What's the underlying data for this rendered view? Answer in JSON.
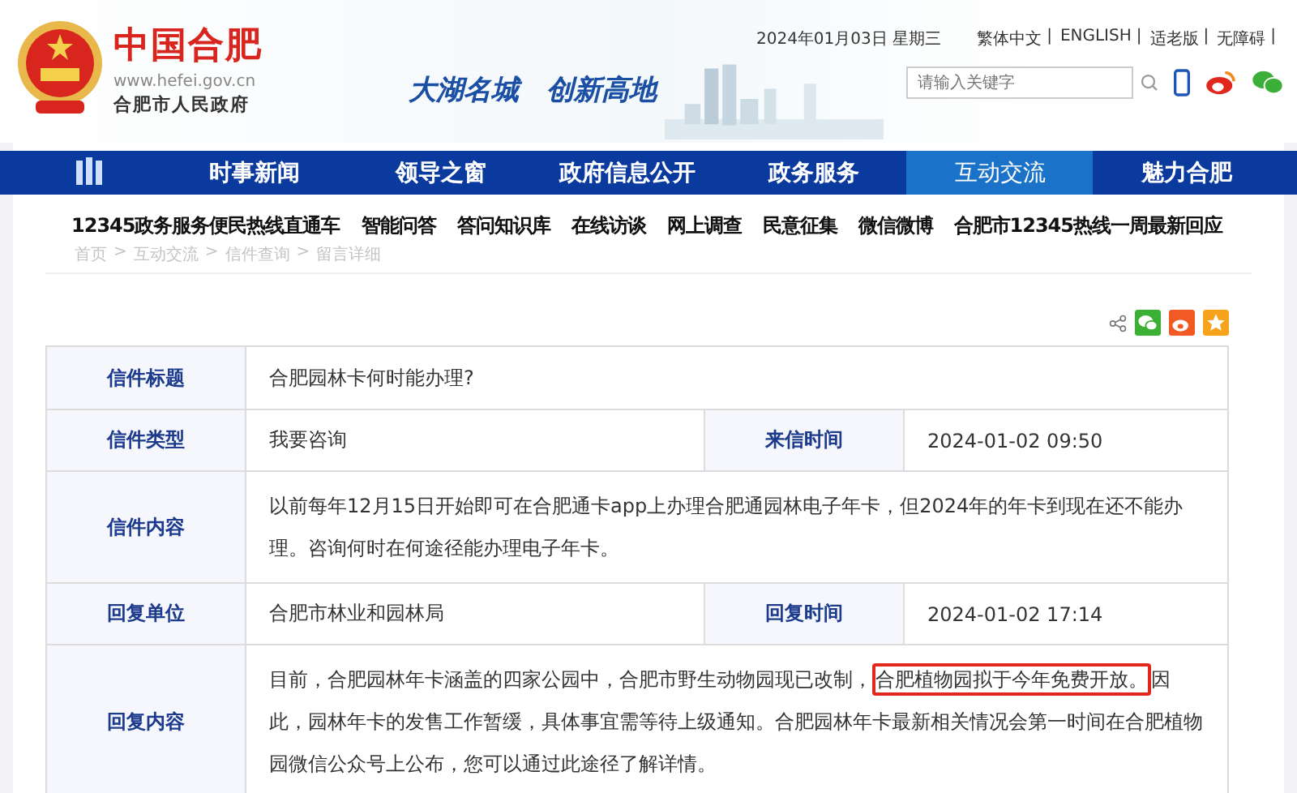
{
  "header": {
    "site_title": "中国合肥",
    "url": "www.hefei.gov.cn",
    "org_name": "合肥市人民政府",
    "slogan": "大湖名城　创新高地",
    "date": "2024年01月03日 星期三",
    "link_separator": "|",
    "links": [
      "繁体中文",
      "ENGLISH",
      "适老版",
      "无障碍"
    ],
    "search": {
      "placeholder": "请输入关键字"
    }
  },
  "nav": [
    {
      "label": "时事新闻",
      "selected": false
    },
    {
      "label": "领导之窗",
      "selected": false
    },
    {
      "label": "政府信息公开",
      "selected": false
    },
    {
      "label": "政务服务",
      "selected": false
    },
    {
      "label": "互动交流",
      "selected": true
    },
    {
      "label": "魅力合肥",
      "selected": false
    }
  ],
  "subnav": [
    "12345政务服务便民热线直通车",
    "智能问答",
    "答问知识库",
    "在线访谈",
    "网上调查",
    "民意征集",
    "微信微博",
    "合肥市12345热线一周最新回应"
  ],
  "breadcrumb": {
    "separator": ">",
    "items": [
      "首页",
      "互动交流",
      "信件查询",
      "留言详细"
    ]
  },
  "letter": {
    "rows": [
      {
        "kind": "full",
        "label": "信件标题",
        "segments": [
          {
            "text": "合肥园林卡何时能办理?",
            "highlighted": false
          }
        ]
      },
      {
        "kind": "pair",
        "label": "信件类型",
        "value": "我要咨询",
        "label_2": "来信时间",
        "value_2": "2024-01-02 09:50"
      },
      {
        "kind": "full",
        "label": "信件内容",
        "segments": [
          {
            "text": "以前每年12月15日开始即可在合肥通卡app上办理合肥通园林电子年卡，但2024年的年卡到现在还不能办理。咨询何时在何途径能办理电子年卡。",
            "highlighted": false
          }
        ]
      },
      {
        "kind": "pair",
        "label": "回复单位",
        "value": "合肥市林业和园林局",
        "label_2": "回复时间",
        "value_2": "2024-01-02 17:14"
      },
      {
        "kind": "full",
        "label": "回复内容",
        "segments": [
          {
            "text": "目前，合肥园林年卡涵盖的四家公园中，合肥市野生动物园现已改制，",
            "highlighted": false
          },
          {
            "text": "合肥植物园拟于今年免费开放。",
            "highlighted": true
          },
          {
            "text": "因此，园林年卡的发售工作暂缓，具体事宜需等待上级通知。合肥园林年卡最新相关情况会第一时间在合肥植物园微信公众号上公布，您可以通过此途径了解详情。",
            "highlighted": false
          }
        ]
      }
    ]
  }
}
